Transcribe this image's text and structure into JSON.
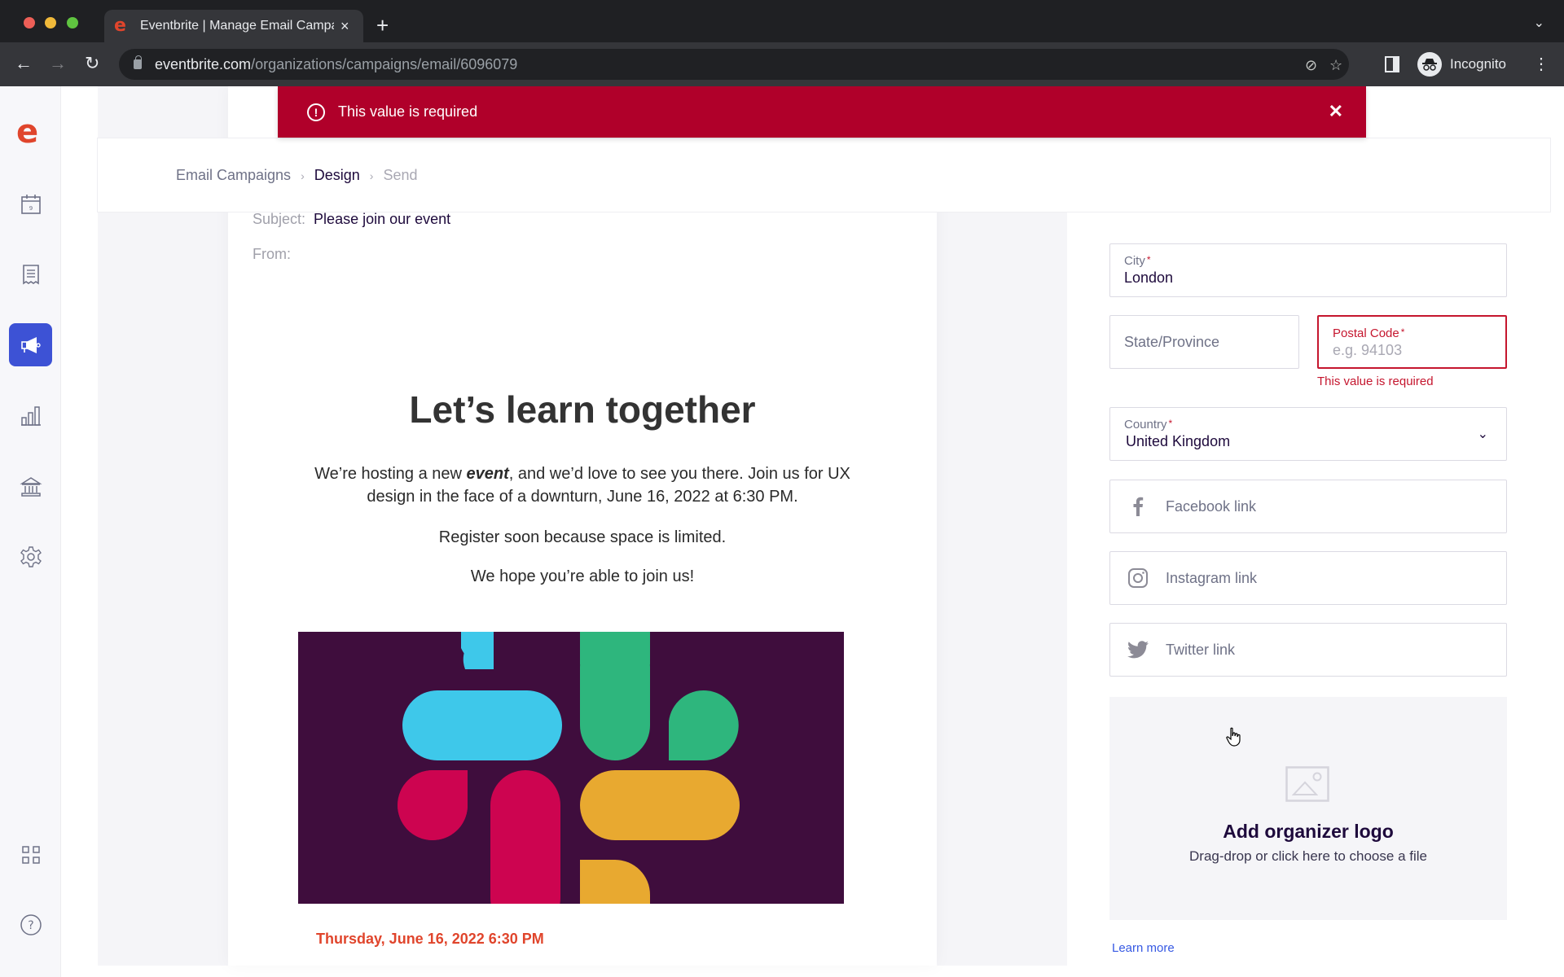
{
  "browser": {
    "tab_title": "Eventbrite | Manage Email Campaigns",
    "favicon": "e",
    "new_tab": "+",
    "tab_close": "×",
    "tab_menu": "⌄",
    "url_host": "eventbrite.com",
    "url_path": "/organizations/campaigns/email/6096079",
    "profile_label": "Incognito",
    "icons": {
      "back": "←",
      "forward": "→",
      "reload": "↻",
      "eye_off": "⊘",
      "star": "☆",
      "menu": "⋮",
      "incognito": "🕶"
    }
  },
  "toast": {
    "icon": "!",
    "message": "This value is required",
    "close": "✕",
    "color": "#b0002a"
  },
  "sidebar": {
    "logo": "e",
    "items": [
      {
        "name": "events",
        "icon": "calendar-icon"
      },
      {
        "name": "orders",
        "icon": "receipt-icon"
      },
      {
        "name": "marketing",
        "icon": "megaphone-icon",
        "active": true
      },
      {
        "name": "reports",
        "icon": "bar-chart-icon"
      },
      {
        "name": "finance",
        "icon": "bank-icon"
      },
      {
        "name": "settings",
        "icon": "gear-icon"
      },
      {
        "name": "apps",
        "icon": "grid-icon"
      },
      {
        "name": "help",
        "icon": "help-icon"
      }
    ],
    "active_color": "#3d52d5"
  },
  "breadcrumb": {
    "items": [
      "Email Campaigns",
      "Design",
      "Send"
    ],
    "separator": "›"
  },
  "email": {
    "subject_label": "Subject:",
    "subject_value": "Please join our event",
    "from_label": "From:",
    "heading": "Let’s learn together",
    "body_part1": "We’re hosting a new ",
    "body_emphasis": "event",
    "body_part2": ", and we’d love to see you there. Join us for UX design in the face of a downturn, June 16, 2022 at 6:30 PM.",
    "register_line": "Register soon because space is limited.",
    "hope_line": "We hope you’re able to join us!",
    "event_date": "Thursday, June 16, 2022 6:30 PM"
  },
  "form": {
    "city": {
      "label": "City",
      "value": "London",
      "required": "*"
    },
    "state": {
      "label": "State/Province"
    },
    "postal": {
      "label": "Postal Code",
      "placeholder": "e.g. 94103",
      "required": "*",
      "error": "This value is required"
    },
    "country": {
      "label": "Country",
      "value": "United Kingdom",
      "required": "*",
      "chevron": "⌄"
    },
    "facebook": {
      "label": "Facebook link"
    },
    "instagram": {
      "label": "Instagram link"
    },
    "twitter": {
      "label": "Twitter link"
    },
    "logo_upload": {
      "title": "Add organizer logo",
      "subtitle": "Drag-drop or click here to choose a file"
    },
    "learn_more": "Learn more"
  }
}
